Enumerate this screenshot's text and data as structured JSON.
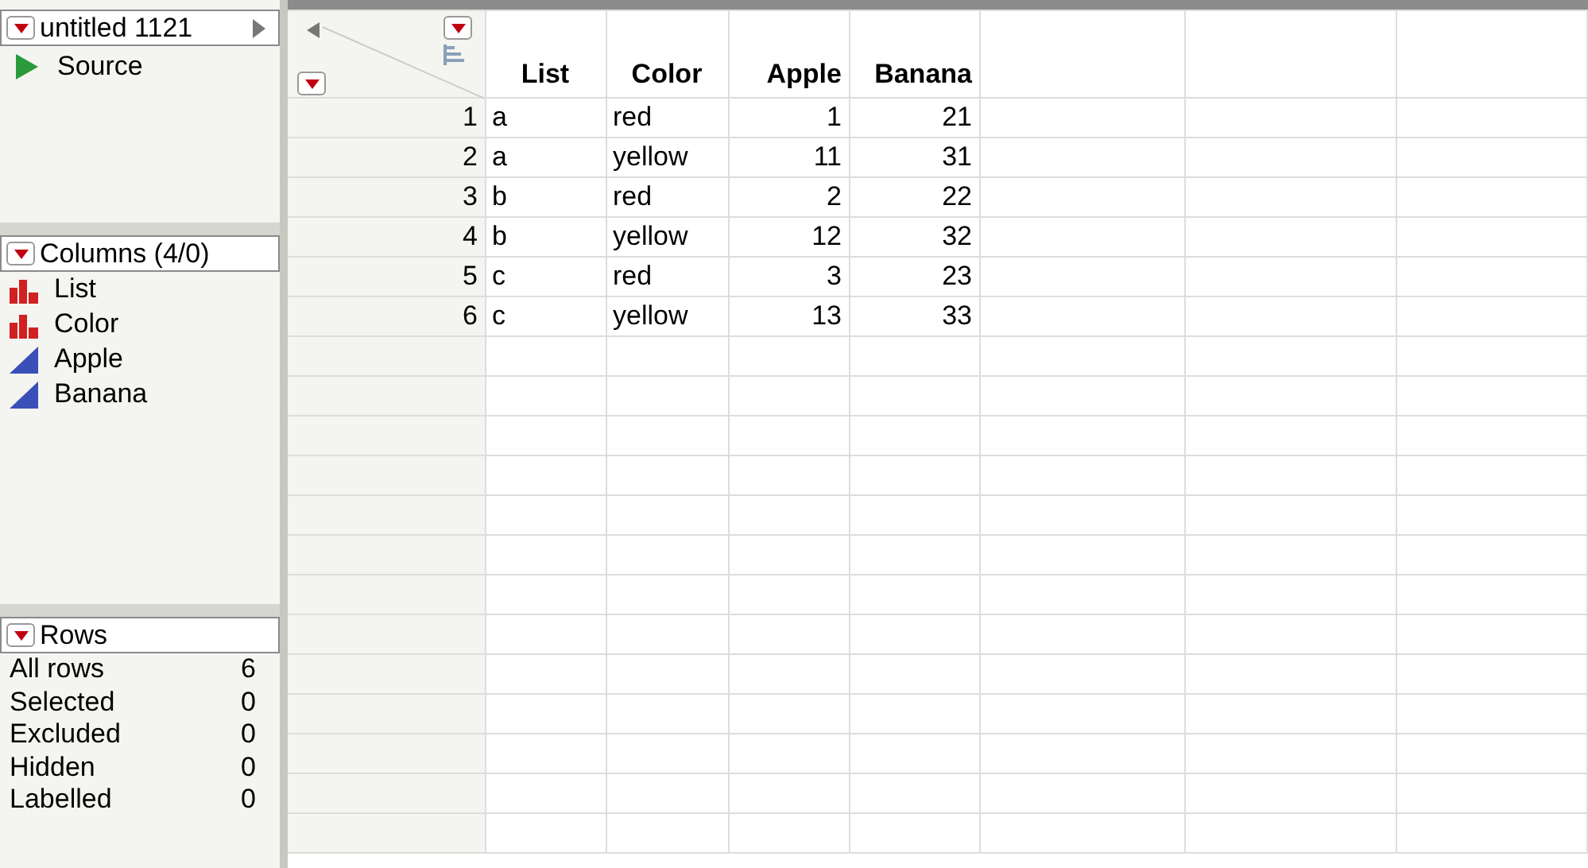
{
  "table_panel": {
    "title": "untitled 1121",
    "scripts": [
      {
        "label": "Source"
      }
    ]
  },
  "columns_panel": {
    "title": "Columns (4/0)",
    "columns": [
      {
        "name": "List",
        "kind": "nominal"
      },
      {
        "name": "Color",
        "kind": "nominal"
      },
      {
        "name": "Apple",
        "kind": "continuous"
      },
      {
        "name": "Banana",
        "kind": "continuous"
      }
    ]
  },
  "rows_panel": {
    "title": "Rows",
    "stats": [
      {
        "label": "All rows",
        "value": "6"
      },
      {
        "label": "Selected",
        "value": "0"
      },
      {
        "label": "Excluded",
        "value": "0"
      },
      {
        "label": "Hidden",
        "value": "0"
      },
      {
        "label": "Labelled",
        "value": "0"
      }
    ]
  },
  "table": {
    "columns": [
      {
        "name": "List",
        "kind": "nominal"
      },
      {
        "name": "Color",
        "kind": "nominal"
      },
      {
        "name": "Apple",
        "kind": "continuous"
      },
      {
        "name": "Banana",
        "kind": "continuous"
      }
    ],
    "rows": [
      {
        "number": "1",
        "cells": [
          "a",
          "red",
          "1",
          "21"
        ]
      },
      {
        "number": "2",
        "cells": [
          "a",
          "yellow",
          "11",
          "31"
        ]
      },
      {
        "number": "3",
        "cells": [
          "b",
          "red",
          "2",
          "22"
        ]
      },
      {
        "number": "4",
        "cells": [
          "b",
          "yellow",
          "12",
          "32"
        ]
      },
      {
        "number": "5",
        "cells": [
          "c",
          "red",
          "3",
          "23"
        ]
      },
      {
        "number": "6",
        "cells": [
          "c",
          "yellow",
          "13",
          "33"
        ]
      }
    ]
  }
}
